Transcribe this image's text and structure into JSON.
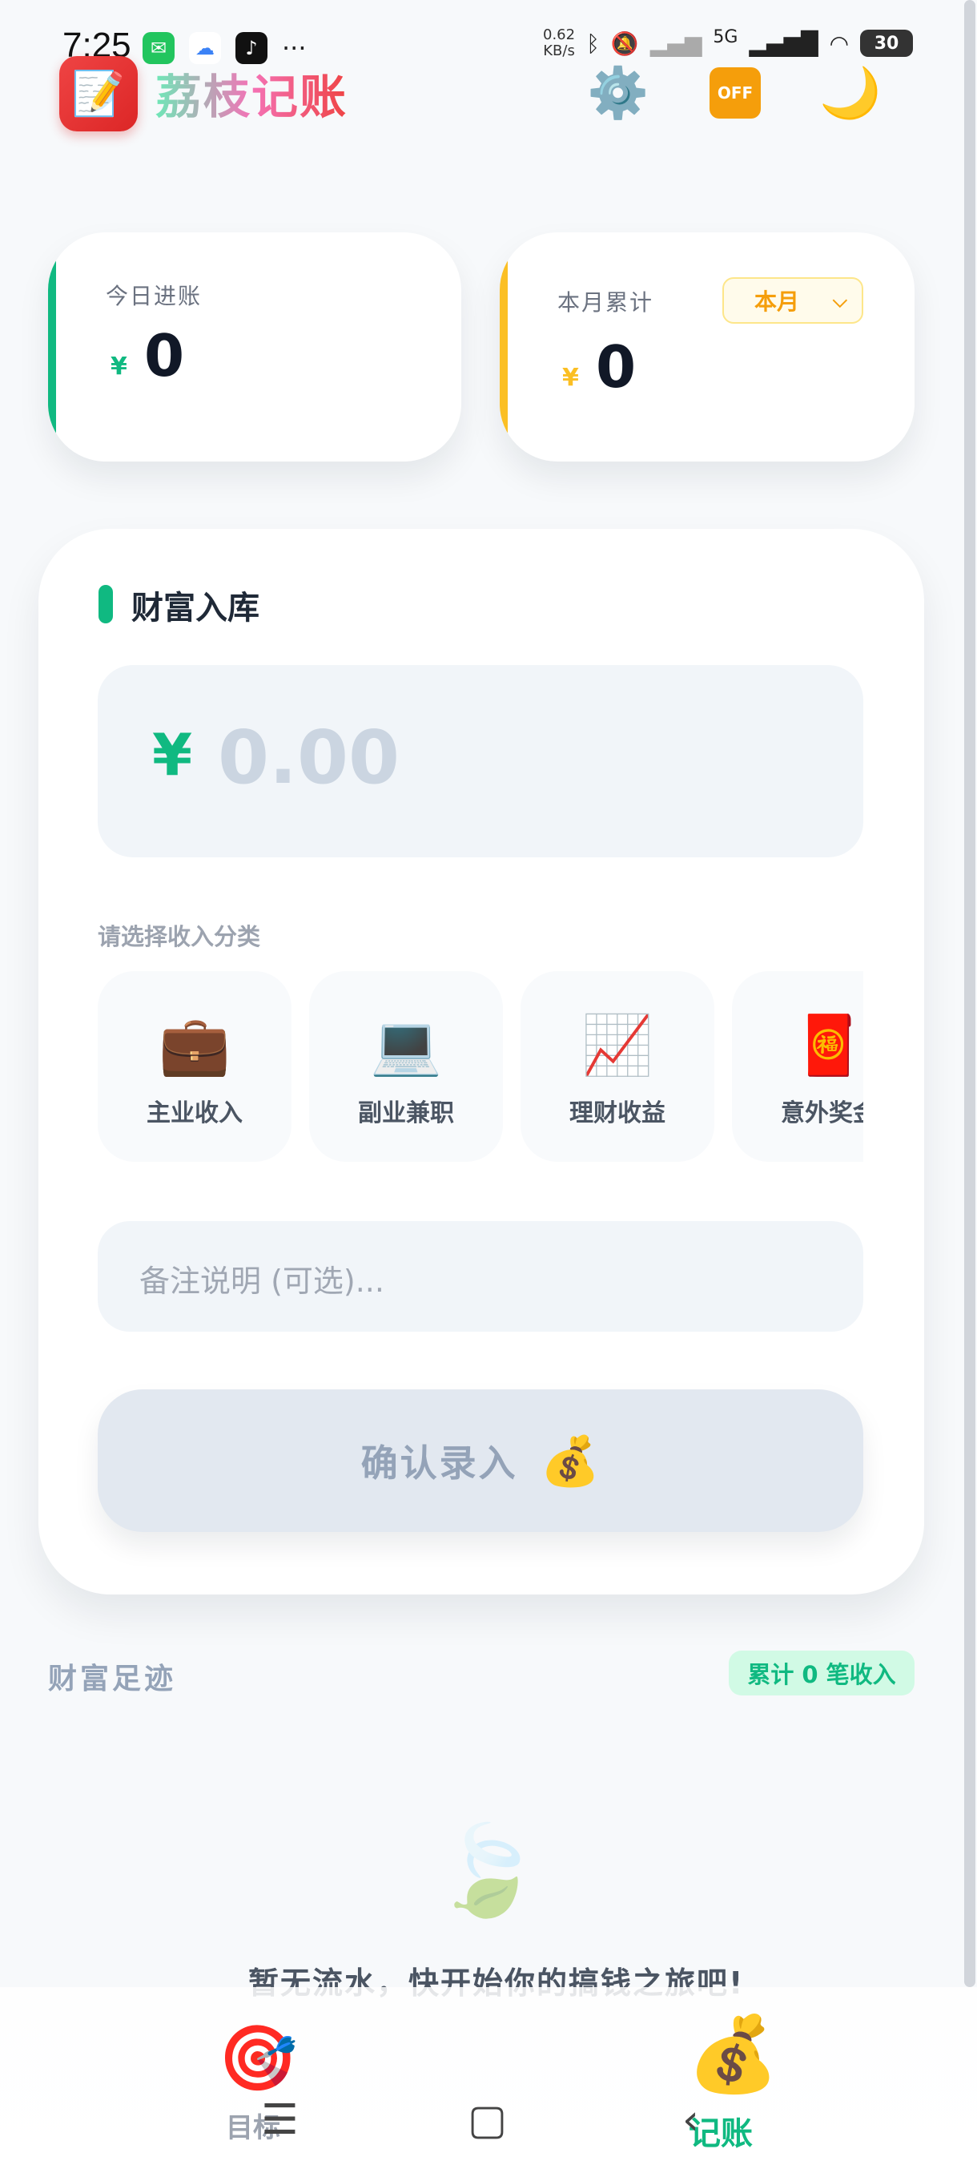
{
  "status": {
    "time": "7:25",
    "net_speed_value": "0.62",
    "net_speed_unit": "KB/s",
    "signal_label": "5G",
    "battery": "30"
  },
  "header": {
    "title": "荔枝记账",
    "logo_icon": "memo-icon",
    "settings_icon": "gear-icon",
    "off_icon_text": "OFF",
    "theme_icon": "moon-icon"
  },
  "today": {
    "label": "今日进账",
    "currency": "¥",
    "value": "0",
    "accent": "#10b981"
  },
  "month": {
    "label": "本月累计",
    "currency": "¥",
    "value": "0",
    "select": "本月",
    "accent": "#fbbf24"
  },
  "entry": {
    "title": "财富入库",
    "currency": "¥",
    "amount_placeholder": "0.00",
    "category_prompt": "请选择收入分类",
    "categories": [
      {
        "icon": "briefcase-icon",
        "glyph": "💼",
        "label": "主业收入"
      },
      {
        "icon": "laptop-icon",
        "glyph": "💻",
        "label": "副业兼职"
      },
      {
        "icon": "chart-up-icon",
        "glyph": "📈",
        "label": "理财收益"
      },
      {
        "icon": "red-envelope-icon",
        "glyph": "🧧",
        "label": "意外奖金"
      }
    ],
    "note_placeholder": "备注说明 (可选)...",
    "confirm_label": "确认录入",
    "confirm_icon": "money-bag-icon"
  },
  "footprint": {
    "title": "财富足迹",
    "badge": "累计 0 笔收入",
    "empty_text": "暂无流水，快开始你的搞钱之旅吧!"
  },
  "nav": {
    "goal_label": "目标",
    "account_label": "记账"
  },
  "colors": {
    "primary": "#10b981",
    "gold": "#f59e0b"
  }
}
